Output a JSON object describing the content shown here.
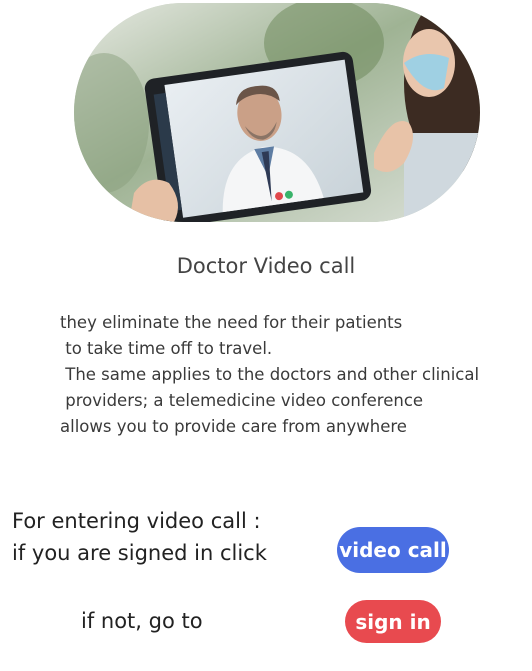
{
  "hero_image": {
    "alt": "Doctor on tablet video call"
  },
  "title": "Doctor Video call",
  "description": {
    "lines": [
      "they eliminate the need for their patients",
      " to take time off to travel.",
      " The same applies to the doctors and other clinical",
      " providers; a telemedicine video conference",
      "allows you to provide care from anywhere"
    ]
  },
  "signed_in_prompt": {
    "line1": "For entering video call :",
    "line2": "if you are signed in click"
  },
  "video_call_button": {
    "label": "video call",
    "color": "#4a6fe3"
  },
  "not_signed_prompt": "if not, go to",
  "sign_in_button": {
    "label": "sign in",
    "color": "#e84a4f"
  }
}
